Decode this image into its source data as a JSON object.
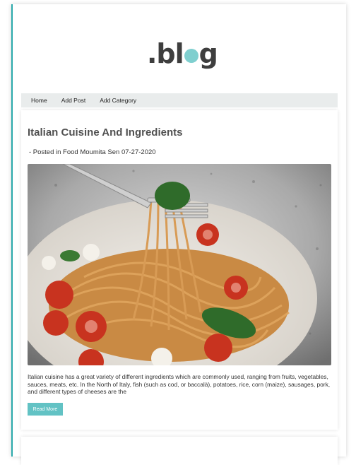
{
  "logo": {
    "prefix": ".bl",
    "suffix": "g"
  },
  "nav": {
    "items": [
      {
        "label": "Home"
      },
      {
        "label": "Add Post"
      },
      {
        "label": "Add Category"
      }
    ]
  },
  "post": {
    "title": "Italian Cuisine And Ingredients",
    "meta": "- Posted in Food Moumita Sen 07-27-2020",
    "excerpt": "Italian cuisine has a great variety of different ingredients which are commonly used, ranging from fruits, vegetables, sauces, meats, etc. In the North of Italy, fish (such as cod, or baccalà), potatoes, rice, corn (maize), sausages, pork, and different types of cheeses are the",
    "read_more_label": "Read More"
  },
  "colors": {
    "accent": "#2aa9ab",
    "button": "#62c2c4",
    "logo_dot": "#7fcfcf",
    "nav_bg": "#e9ecec"
  }
}
